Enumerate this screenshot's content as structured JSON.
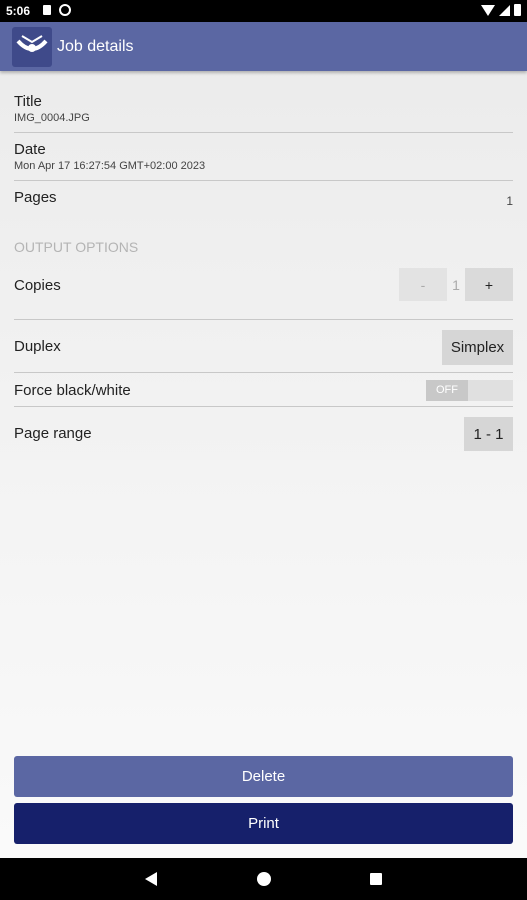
{
  "status_bar": {
    "time": "5:06"
  },
  "toolbar": {
    "title": "Job details",
    "app_icon": "printer-app-icon"
  },
  "job": {
    "title_label": "Title",
    "title_value": "IMG_0004.JPG",
    "date_label": "Date",
    "date_value": "Mon Apr 17 16:27:54 GMT+02:00 2023",
    "pages_label": "Pages",
    "pages_value": "1"
  },
  "output_options": {
    "header": "OUTPUT OPTIONS",
    "copies_label": "Copies",
    "copies_minus": "-",
    "copies_value": "1",
    "copies_plus": "+",
    "duplex_label": "Duplex",
    "duplex_value": "Simplex",
    "force_bw_label": "Force black/white",
    "force_bw_toggle": "OFF",
    "page_range_label": "Page range",
    "page_range_value": "1 - 1"
  },
  "actions": {
    "delete_label": "Delete",
    "print_label": "Print"
  },
  "colors": {
    "toolbar": "#5b67a3",
    "print_button": "#16206b",
    "delete_button": "#5b67a3"
  }
}
